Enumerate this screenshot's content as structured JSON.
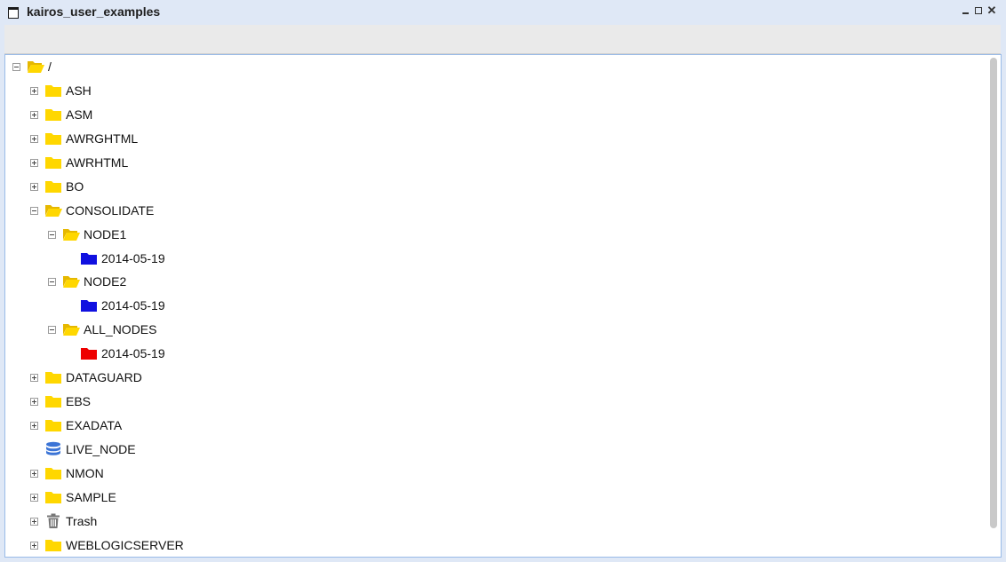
{
  "window": {
    "title": "kairos_user_examples"
  },
  "colors": {
    "folder_yellow": "#ffd700",
    "folder_blue": "#1010e0",
    "folder_red": "#ee0000",
    "database_blue": "#3b74d6",
    "trash_gray": "#777777"
  },
  "tree": {
    "root": {
      "label": "/",
      "icon": "folder-open-icon",
      "state": "expanded"
    },
    "items": [
      {
        "label": "ASH",
        "icon": "folder-icon",
        "state": "collapsed"
      },
      {
        "label": "ASM",
        "icon": "folder-icon",
        "state": "collapsed"
      },
      {
        "label": "AWRGHTML",
        "icon": "folder-icon",
        "state": "collapsed"
      },
      {
        "label": "AWRHTML",
        "icon": "folder-icon",
        "state": "collapsed"
      },
      {
        "label": "BO",
        "icon": "folder-icon",
        "state": "collapsed"
      },
      {
        "label": "CONSOLIDATE",
        "icon": "folder-open-icon",
        "state": "expanded"
      },
      {
        "label": "NODE1",
        "icon": "folder-open-icon",
        "state": "expanded"
      },
      {
        "label": "2014-05-19",
        "icon": "folder-blue-icon",
        "state": "leaf"
      },
      {
        "label": "NODE2",
        "icon": "folder-open-icon",
        "state": "expanded"
      },
      {
        "label": "2014-05-19",
        "icon": "folder-blue-icon",
        "state": "leaf"
      },
      {
        "label": "ALL_NODES",
        "icon": "folder-open-icon",
        "state": "expanded"
      },
      {
        "label": "2014-05-19",
        "icon": "folder-red-icon",
        "state": "leaf"
      },
      {
        "label": "DATAGUARD",
        "icon": "folder-icon",
        "state": "collapsed"
      },
      {
        "label": "EBS",
        "icon": "folder-icon",
        "state": "collapsed"
      },
      {
        "label": "EXADATA",
        "icon": "folder-icon",
        "state": "collapsed"
      },
      {
        "label": "LIVE_NODE",
        "icon": "database-icon",
        "state": "leaf"
      },
      {
        "label": "NMON",
        "icon": "folder-icon",
        "state": "collapsed"
      },
      {
        "label": "SAMPLE",
        "icon": "folder-icon",
        "state": "collapsed"
      },
      {
        "label": "Trash",
        "icon": "trash-icon",
        "state": "collapsed"
      },
      {
        "label": "WEBLOGICSERVER",
        "icon": "folder-icon",
        "state": "collapsed"
      }
    ]
  }
}
